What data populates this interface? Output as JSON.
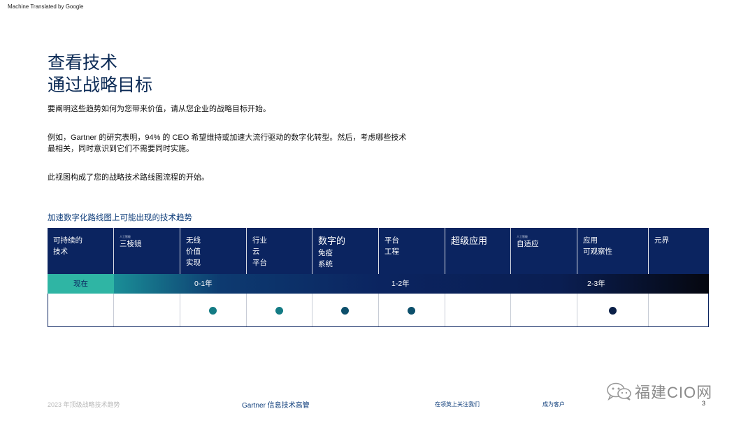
{
  "machine_translated_label": "Machine Translated by Google",
  "title_line1": "查看技术",
  "title_line2": "通过战略目标",
  "paragraphs": {
    "p1": "要阐明这些趋势如何为您带来价值，请从您企业的战略目标开始。",
    "p2_line1": "例如，Gartner 的研究表明，94% 的 CEO 希望维持或加速大流行驱动的数字化转型。然后，考虑哪些技术",
    "p2_line2": "最相关，同时意识到它们不需要同时实施。",
    "p3": "此视图构成了您的战略技术路线图流程的开始。"
  },
  "section_heading": "加速数字化路线图上可能出现的技术趋势",
  "header_cells": [
    {
      "lines": [
        "可持续的",
        "技术"
      ],
      "big": false,
      "tiny": ""
    },
    {
      "lines": [
        "三棱镜"
      ],
      "big": false,
      "tiny": "人工智能"
    },
    {
      "lines": [
        "无线",
        "价值",
        "实现"
      ],
      "big": false,
      "tiny": ""
    },
    {
      "lines": [
        "行业",
        "云",
        "平台"
      ],
      "big": false,
      "tiny": ""
    },
    {
      "lines": [
        "数字的",
        "免疫",
        "系统"
      ],
      "big": true,
      "tiny": ""
    },
    {
      "lines": [
        "平台",
        "工程"
      ],
      "big": false,
      "tiny": ""
    },
    {
      "lines": [
        "超级应用"
      ],
      "big": true,
      "tiny": ""
    },
    {
      "lines": [
        "自适应"
      ],
      "big": false,
      "tiny": "人工智能"
    },
    {
      "lines": [
        "应用",
        "可观察性"
      ],
      "big": false,
      "tiny": ""
    },
    {
      "lines": [
        "元界"
      ],
      "big": false,
      "tiny": ""
    }
  ],
  "timeline": {
    "now_label": "现在",
    "period_1": "0-1年",
    "period_2": "1-2年",
    "period_3": "2-3年"
  },
  "dots": [
    {
      "has_dot": false,
      "color": ""
    },
    {
      "has_dot": false,
      "color": ""
    },
    {
      "has_dot": true,
      "color": "#137b84"
    },
    {
      "has_dot": true,
      "color": "#137b84"
    },
    {
      "has_dot": true,
      "color": "#0c4f6b"
    },
    {
      "has_dot": true,
      "color": "#0c4f6b"
    },
    {
      "has_dot": false,
      "color": ""
    },
    {
      "has_dot": false,
      "color": ""
    },
    {
      "has_dot": true,
      "color": "#0b2048"
    },
    {
      "has_dot": false,
      "color": ""
    }
  ],
  "footer": {
    "left": "2023 年顶级战略技术趋势",
    "middle": "Gartner 信息技术高管",
    "follow": "在领英上关注我们",
    "client": "成为客户",
    "page_number": "3"
  },
  "watermark": {
    "text": "福建CIO网",
    "icon": "wechat-icon"
  },
  "colors": {
    "navy": "#0b2460",
    "teal": "#2fb5a4",
    "title_blue": "#0b2a55"
  }
}
